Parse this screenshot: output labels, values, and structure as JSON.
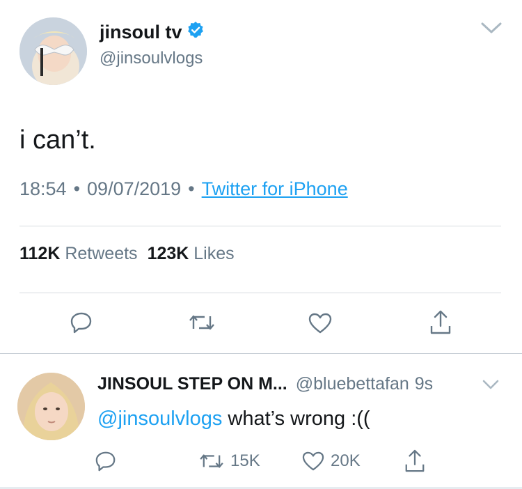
{
  "tweet": {
    "author_name": "jinsoul tv",
    "author_handle": "@jinsoulvlogs",
    "verified": true,
    "text": "i can’t.",
    "time": "18:54",
    "separator": "•",
    "date": "09/07/2019",
    "source": "Twitter for iPhone",
    "retweets_count": "112K",
    "retweets_label": "Retweets",
    "likes_count": "123K",
    "likes_label": "Likes",
    "actions": [
      "reply-icon",
      "retweet-icon",
      "like-icon",
      "share-icon"
    ]
  },
  "reply": {
    "author_name": "JINSOUL STEP ON M...",
    "author_handle": "@bluebettafan",
    "time": "9s",
    "mention": "@jinsoulvlogs",
    "text": " what’s wrong :((",
    "retweet_count": "15K",
    "like_count": "20K",
    "actions": [
      "reply-icon",
      "retweet-icon",
      "like-icon",
      "share-icon"
    ]
  },
  "colors": {
    "text": "#14171a",
    "secondary": "#657786",
    "link": "#1da1f2",
    "divider": "#d6dbe0"
  }
}
